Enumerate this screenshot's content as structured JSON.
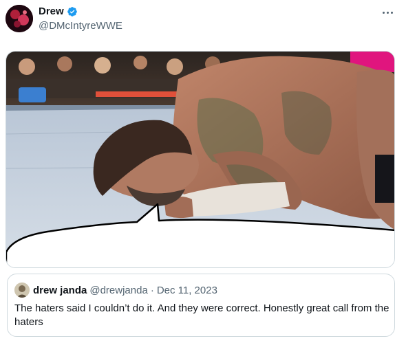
{
  "tweet": {
    "author": {
      "display_name": "Drew",
      "handle": "@DMcIntyreWWE",
      "verified": true,
      "avatar_icon": "profile-avatar"
    },
    "more_icon": "more-options-icon",
    "media": {
      "alt": "Wrestler lying face down on the ring mat with a speech bubble"
    },
    "quote": {
      "author_name": "drew janda",
      "author_handle": "@drewjanda",
      "separator": "·",
      "date": "Dec 11, 2023",
      "text": "The haters said I couldn’t do it. And they were correct. Honestly great call from the haters"
    }
  },
  "colors": {
    "verified_blue": "#1d9bf0",
    "secondary_text": "#536471",
    "border": "#cfd9de"
  }
}
